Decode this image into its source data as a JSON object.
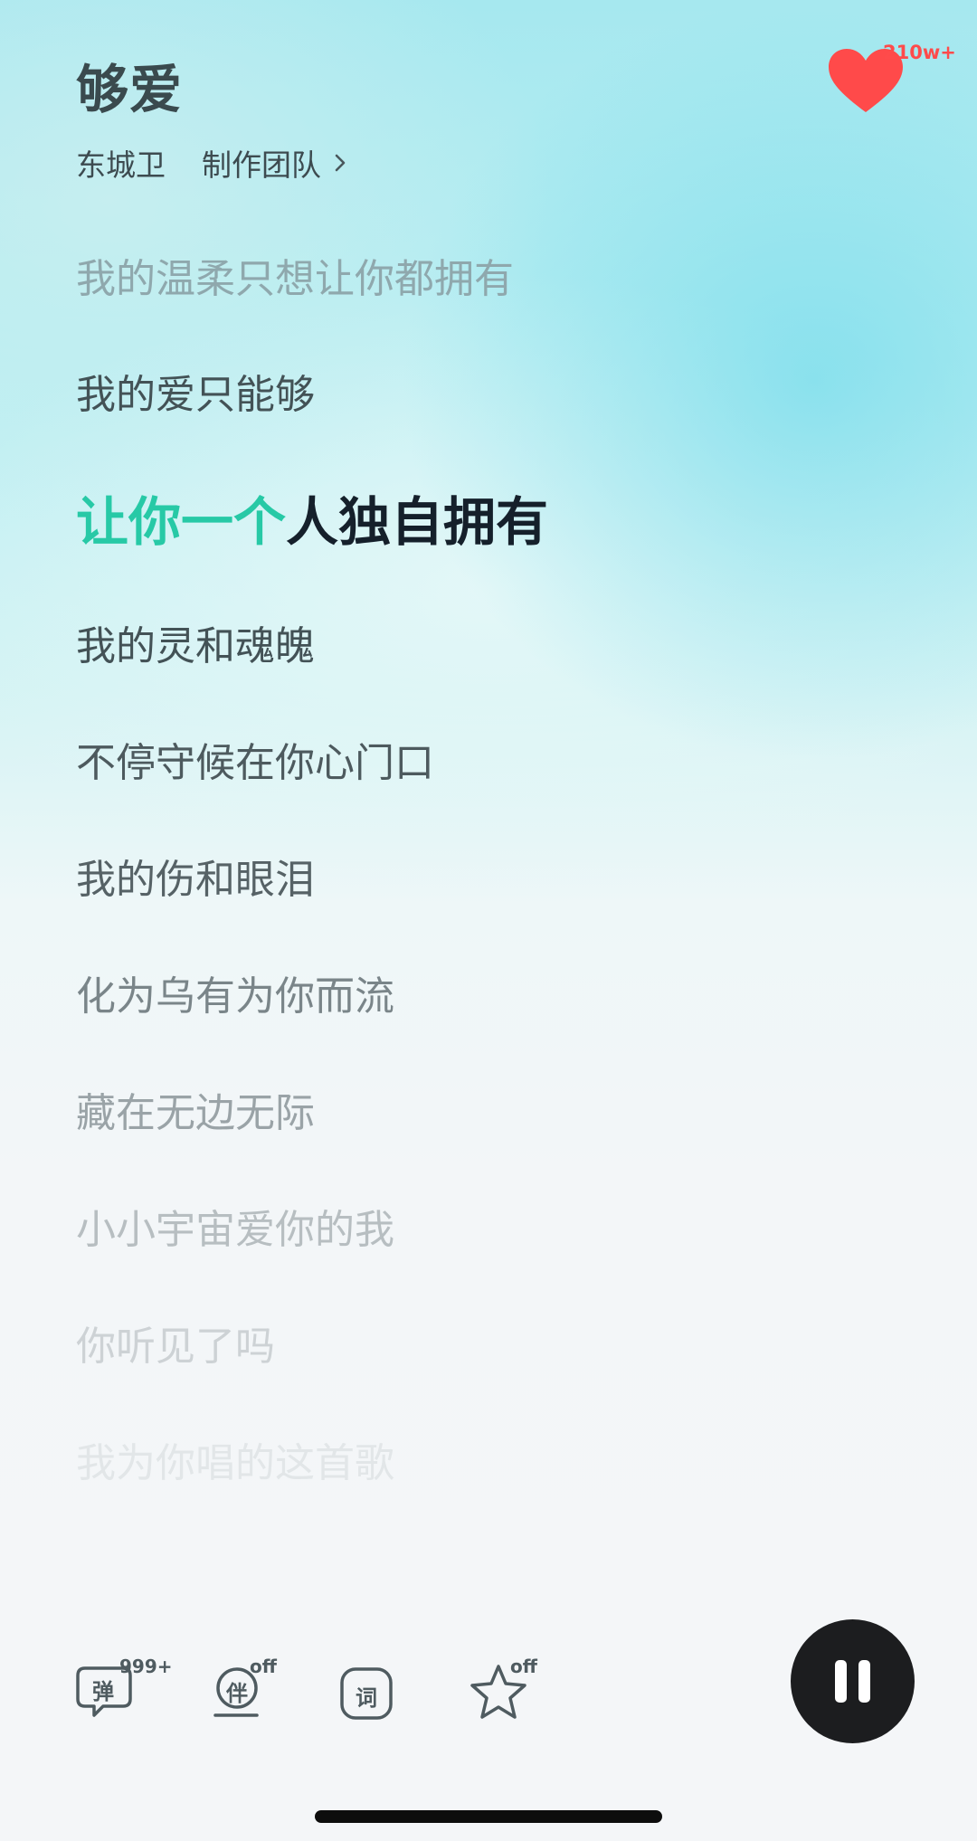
{
  "song": {
    "title": "够爱",
    "artist": "东城卫",
    "team_label": "制作团队"
  },
  "like": {
    "count": "210w+",
    "color": "#ff4b4b"
  },
  "lyrics": {
    "lines": [
      "我的温柔只想让你都拥有",
      "我的爱只能够",
      "我的灵和魂魄",
      "不停守候在你心门口",
      "我的伤和眼泪",
      "化为乌有为你而流",
      "藏在无边无际",
      "小小宇宙爱你的我",
      "你听见了吗",
      "我为你唱的这首歌"
    ],
    "current_sung": "让你一个",
    "current_rest": "人独自拥有",
    "highlight_color": "#27c9a6"
  },
  "toolbar": {
    "danmaku_label": "弹",
    "danmaku_count": "999+",
    "accompany_label": "伴",
    "accompany_state": "off",
    "lyrics_label": "词",
    "favorite_state": "off"
  },
  "player": {
    "state": "playing",
    "control_icon": "pause-icon"
  }
}
